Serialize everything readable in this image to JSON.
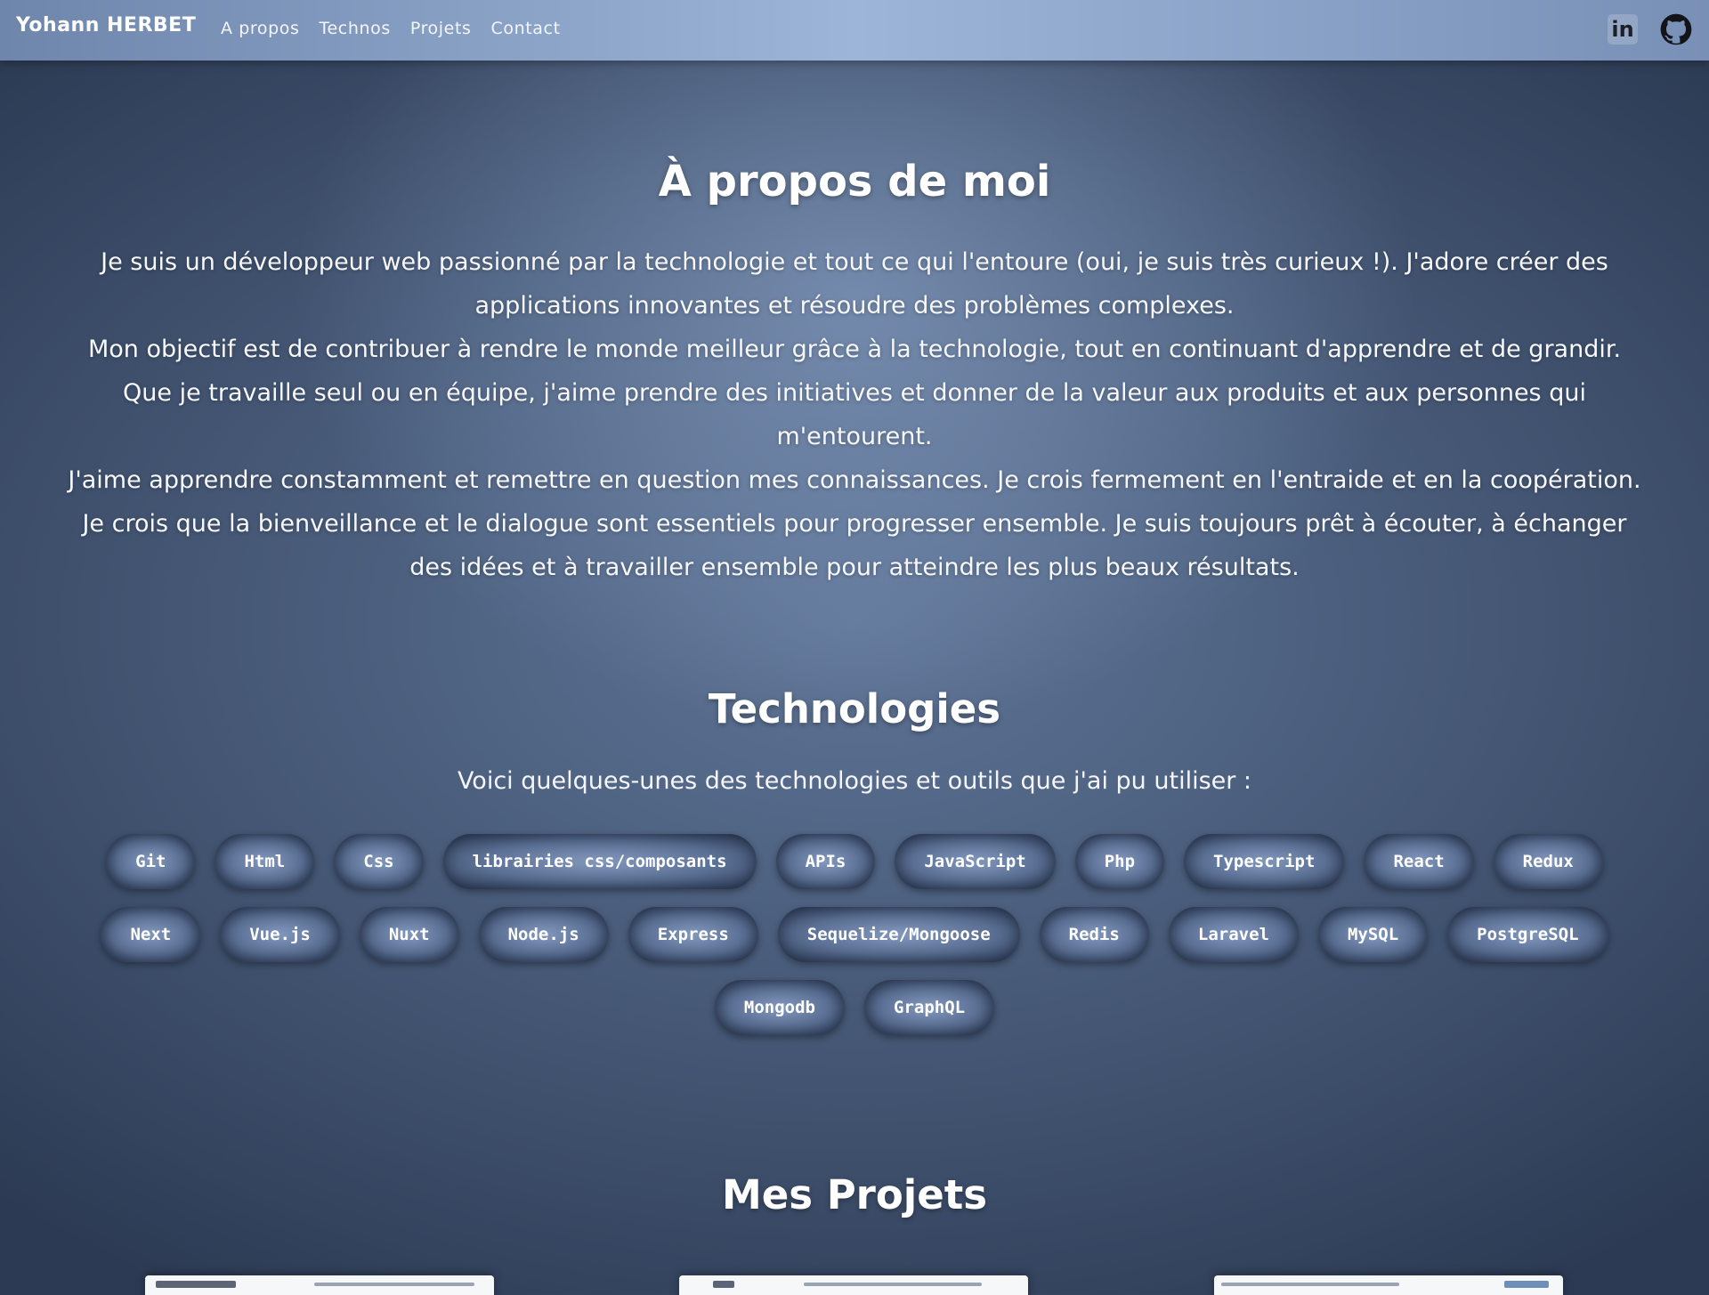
{
  "navbar": {
    "brand": "Yohann HERBET",
    "links": [
      {
        "label": "A propos"
      },
      {
        "label": "Technos"
      },
      {
        "label": "Projets"
      },
      {
        "label": "Contact"
      }
    ],
    "icons": [
      "linkedin-icon",
      "github-icon"
    ]
  },
  "about": {
    "title": "À propos de moi",
    "paragraphs": [
      "Je suis un développeur web passionné par la technologie et tout ce qui l'entoure (oui, je suis très curieux !). J'adore créer des applications innovantes et résoudre des problèmes complexes.",
      "Mon objectif est de contribuer à rendre le monde meilleur grâce à la technologie, tout en continuant d'apprendre et de grandir. Que je travaille seul ou en équipe, j'aime prendre des initiatives et donner de la valeur aux produits et aux personnes qui m'entourent.",
      "J'aime apprendre constamment et remettre en question mes connaissances. Je crois fermement en l'entraide et en la coopération. Je crois que la bienveillance et le dialogue sont essentiels pour progresser ensemble. Je suis toujours prêt à écouter, à échanger des idées et à travailler ensemble pour atteindre les plus beaux résultats."
    ]
  },
  "technologies": {
    "title": "Technologies",
    "intro": "Voici quelques-unes des technologies et outils que j'ai pu utiliser :",
    "items": [
      "Git",
      "Html",
      "Css",
      "librairies css/composants",
      "APIs",
      "JavaScript",
      "Php",
      "Typescript",
      "React",
      "Redux",
      "Next",
      "Vue.js",
      "Nuxt",
      "Node.js",
      "Express",
      "Sequelize/Mongoose",
      "Redis",
      "Laravel",
      "MySQL",
      "PostgreSQL",
      "Mongodb",
      "GraphQL"
    ]
  },
  "projects": {
    "title": "Mes Projets"
  },
  "colors": {
    "navbar_accent": "#9cb5d8",
    "background_dark": "#2c3a53",
    "chip_center": "#8197bb"
  }
}
